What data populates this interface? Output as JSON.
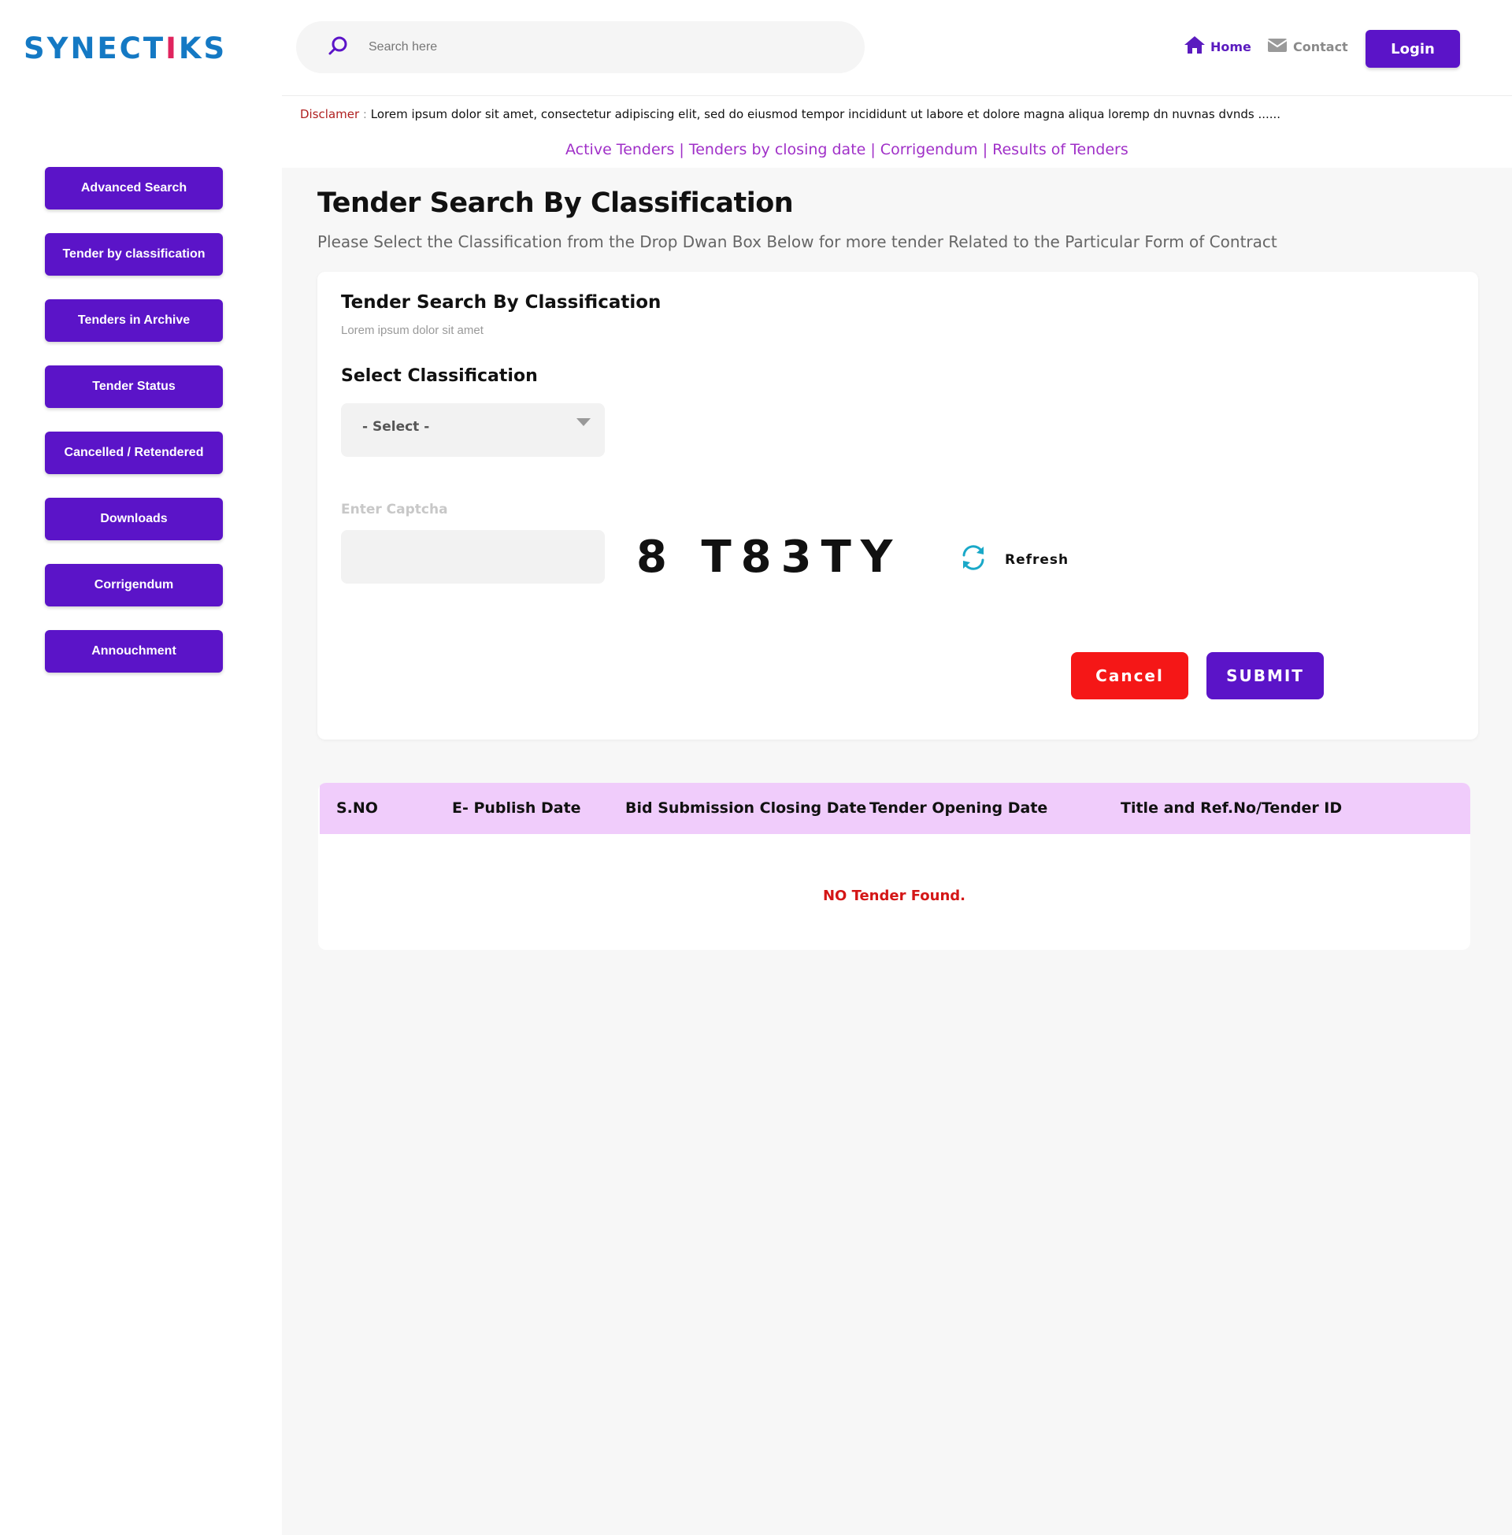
{
  "brand": {
    "logo_text_a": "SYNECT",
    "logo_text_b": "I",
    "logo_text_c": "KS",
    "primary_color": "#5b14c8",
    "logo_color": "#1479c4"
  },
  "header": {
    "search_placeholder": "Search here",
    "home_label": "Home",
    "contact_label": "Contact",
    "login_label": "Login"
  },
  "disclaimer": {
    "label": "Disclamer",
    "separator": " : ",
    "text": "Lorem ipsum dolor sit amet, consectetur adipiscing elit, sed do eiusmod tempor incididunt ut labore et dolore magna aliqua loremp dn  nuvnas dvnds ......"
  },
  "quick_links": "Active Tenders  | Tenders by closing date | Corrigendum | Results of Tenders",
  "sidebar": {
    "items": [
      {
        "label": "Advanced Search"
      },
      {
        "label": "Tender by classification"
      },
      {
        "label": "Tenders in Archive"
      },
      {
        "label": "Tender Status"
      },
      {
        "label": "Cancelled / Retendered"
      },
      {
        "label": "Downloads"
      },
      {
        "label": "Corrigendum"
      },
      {
        "label": "Annouchment"
      }
    ]
  },
  "main": {
    "title": "Tender Search By Classification",
    "subtitle": "Please Select the Classification from the Drop Dwan Box Below for more tender Related to the Particular Form of Contract"
  },
  "form": {
    "title": "Tender Search By Classification",
    "subtitle": "Lorem ipsum dolor sit amet",
    "select_label": "Select Classification",
    "select_value": "- Select -",
    "captcha_label": "Enter Captcha",
    "captcha_code": "8 T83TY",
    "refresh_label": "Refresh",
    "cancel_label": "Cancel",
    "submit_label": "SUBMIT"
  },
  "results": {
    "columns": [
      "S.NO",
      "E- Publish Date",
      "Bid Submission Closing Date",
      "Tender Opening Date",
      "Title and Ref.No/Tender ID"
    ],
    "empty_message": "NO Tender Found."
  }
}
